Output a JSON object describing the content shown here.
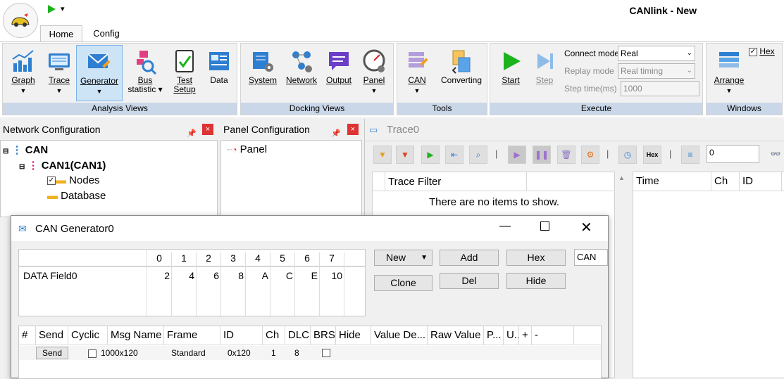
{
  "window": {
    "title": "CANlink - New",
    "quick_menu": "▾"
  },
  "tabs": [
    {
      "label": "Home"
    },
    {
      "label": "Config"
    }
  ],
  "ribbon": {
    "analysis": {
      "label": "Analysis Views",
      "buttons": [
        {
          "label": "Graph"
        },
        {
          "label": "Trace"
        },
        {
          "label": "Generator"
        },
        {
          "label1": "Bus",
          "label2": "statistic"
        },
        {
          "label1": "Test",
          "label2": "Setup"
        },
        {
          "label": "Data"
        }
      ]
    },
    "docking": {
      "label": "Docking Views",
      "buttons": [
        {
          "label": "System"
        },
        {
          "label": "Network"
        },
        {
          "label": "Output"
        },
        {
          "label": "Panel"
        }
      ]
    },
    "tools": {
      "label": "Tools",
      "buttons": [
        {
          "label": "CAN"
        },
        {
          "label": "Converting"
        }
      ]
    },
    "execute": {
      "label": "Execute",
      "start": "Start",
      "step": "Step",
      "connect_mode_label": "Connect mode",
      "connect_mode_value": "Real",
      "replay_mode_label": "Replay mode",
      "replay_mode_value": "Real timing",
      "step_time_label": "Step time(ms)",
      "step_time_value": "1000"
    },
    "windows": {
      "label": "Windows",
      "arrange": "Arrange",
      "hex": "Hex"
    }
  },
  "network_pane": {
    "title": "Network Configuration",
    "tree": {
      "root": "CAN",
      "channel": "CAN1(CAN1)",
      "nodes": "Nodes",
      "database": "Database"
    }
  },
  "panel_pane": {
    "title": "Panel Configuration",
    "item": "Panel"
  },
  "trace": {
    "title": "Trace0",
    "search_value": "0",
    "hex_btn": "Hex",
    "filter_header": "Trace Filter",
    "empty_text": "There are no items to show.",
    "columns": [
      "Time",
      "Ch",
      "ID"
    ]
  },
  "generator": {
    "title": "CAN Generator0",
    "byte_headers": [
      "0",
      "1",
      "2",
      "3",
      "4",
      "5",
      "6",
      "7"
    ],
    "field_name": "DATA Field0",
    "field_values": [
      "2",
      "4",
      "6",
      "8",
      "A",
      "C",
      "E",
      "10"
    ],
    "buttons": {
      "new": "New",
      "add": "Add",
      "hex": "Hex",
      "clone": "Clone",
      "del": "Del",
      "hide": "Hide"
    },
    "channel_field": "CAN",
    "columns": [
      "#",
      "Send",
      "Cyclic",
      "Msg Name",
      "Frame",
      "ID",
      "Ch",
      "DLC",
      "BRS",
      "Hide",
      "Value De...",
      "Raw Value",
      "P...",
      "U..",
      "+",
      "-"
    ],
    "row": {
      "send": "Send",
      "cyclic": "100",
      "msg_name": "0x120",
      "frame": "Standard",
      "id": "0x120",
      "ch": "1",
      "dlc": "8"
    }
  },
  "colors": {
    "accent": "#c9d7e8",
    "selected": "#cde4f7",
    "close": "#d33333"
  }
}
